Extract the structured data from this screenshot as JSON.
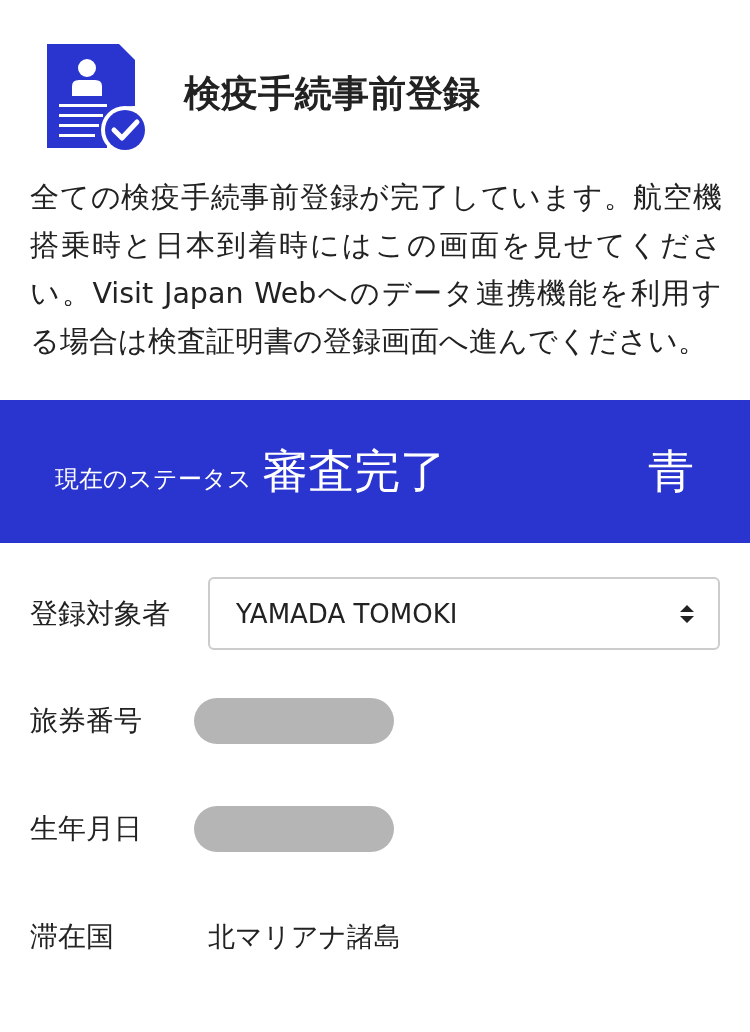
{
  "header": {
    "title": "検疫手続事前登録"
  },
  "message": "全ての検疫手続事前登録が完了しています。航空機搭乗時と日本到着時にはこの画面を見せてください。Visit Japan Webへのデータ連携機能を利用する場合は検査証明書の登録画面へ進んでください。",
  "status": {
    "label": "現在のステータス",
    "value": "審査完了",
    "color_name": "青"
  },
  "fields": [
    {
      "kind": "select",
      "label": "登録対象者",
      "value": "YAMADA TOMOKI"
    },
    {
      "kind": "text",
      "label": "旅券番号",
      "redacted": true
    },
    {
      "kind": "text",
      "label": "生年月日",
      "redacted": true
    },
    {
      "kind": "text",
      "label": "滞在国",
      "value": "北マリアナ諸島",
      "redacted": false
    }
  ]
}
